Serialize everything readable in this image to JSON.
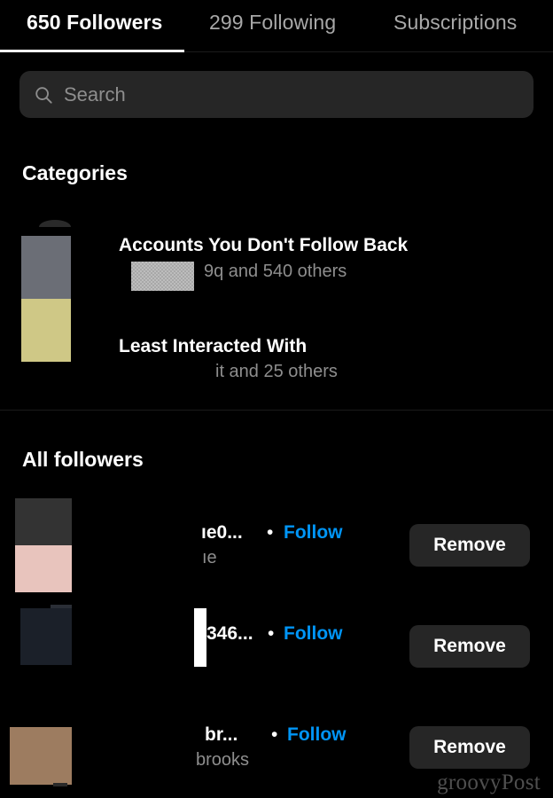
{
  "tabs": [
    {
      "label": "650 Followers",
      "active": true
    },
    {
      "label": "299 Following",
      "active": false
    },
    {
      "label": "Subscriptions",
      "active": false
    }
  ],
  "search": {
    "placeholder": "Search",
    "value": "",
    "icon": "search-icon"
  },
  "categories_section": {
    "title": "Categories",
    "rows": [
      {
        "title": "Accounts You Don't Follow Back",
        "subtitle": "9q and 540 others"
      },
      {
        "title": "Least Interacted With",
        "subtitle": "it and 25 others"
      }
    ]
  },
  "all_followers_section": {
    "title": "All followers",
    "rows": [
      {
        "username": "ıe0...",
        "separator": "•",
        "follow_label": "Follow",
        "fullname": "ıe",
        "remove_label": "Remove"
      },
      {
        "username": "346...",
        "separator": "•",
        "follow_label": "Follow",
        "fullname": "",
        "remove_label": "Remove"
      },
      {
        "username": "br...",
        "separator": "•",
        "follow_label": "Follow",
        "fullname": "brooks",
        "remove_label": "Remove"
      }
    ]
  },
  "watermark": "groovyPost",
  "colors": {
    "background": "#000000",
    "surface": "#262626",
    "accent_blue": "#0095f6",
    "text_primary": "#ffffff",
    "text_secondary": "#8e8e8e",
    "active_underline": "#ffffff"
  }
}
